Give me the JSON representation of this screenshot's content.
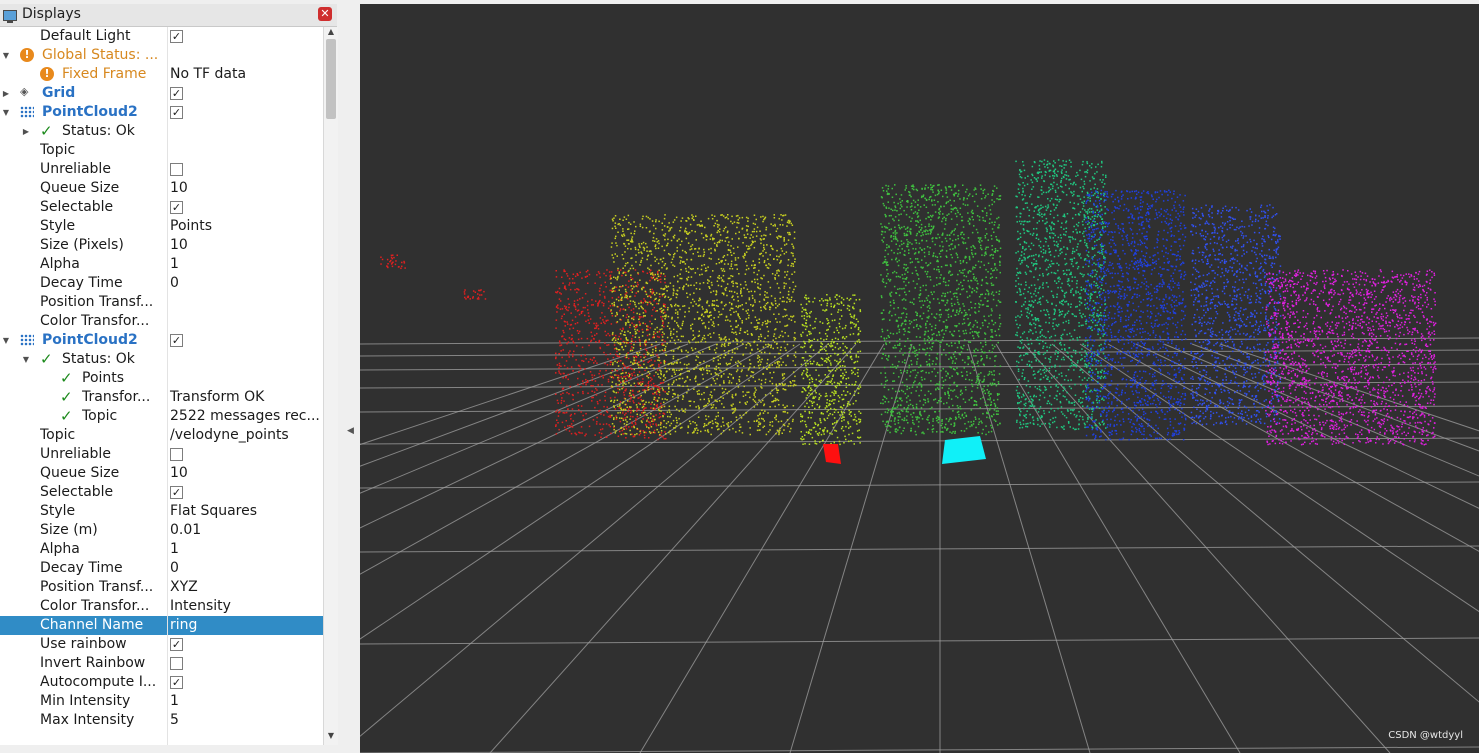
{
  "panel": {
    "title": "Displays",
    "close_glyph": "✕",
    "rows": [
      {
        "indent": 0,
        "arrow": "",
        "icon": "",
        "name": "Default Light",
        "value": "",
        "checkbox": true,
        "checked": true
      },
      {
        "indent": 0,
        "arrow": "▼",
        "icon": "warning",
        "name": "Global Status: ...",
        "value": "",
        "checkbox": false,
        "style": "orange"
      },
      {
        "indent": 1,
        "arrow": "",
        "icon": "warning",
        "name": "Fixed Frame",
        "value": "No TF data",
        "checkbox": false,
        "style": "orange"
      },
      {
        "indent": 0,
        "arrow": "▶",
        "icon": "grid",
        "name": "Grid",
        "value": "",
        "checkbox": true,
        "checked": true,
        "style": "blue"
      },
      {
        "indent": 0,
        "arrow": "▼",
        "icon": "pointcloud",
        "name": "PointCloud2",
        "value": "",
        "checkbox": true,
        "checked": true,
        "style": "blue"
      },
      {
        "indent": 1,
        "arrow": "▶",
        "icon": "check",
        "name": "Status: Ok",
        "value": "",
        "checkbox": false
      },
      {
        "indent": 1,
        "arrow": "",
        "icon": "",
        "name": "Topic",
        "value": "",
        "checkbox": false
      },
      {
        "indent": 1,
        "arrow": "",
        "icon": "",
        "name": "Unreliable",
        "value": "",
        "checkbox": true,
        "checked": false
      },
      {
        "indent": 1,
        "arrow": "",
        "icon": "",
        "name": "Queue Size",
        "value": "10",
        "checkbox": false
      },
      {
        "indent": 1,
        "arrow": "",
        "icon": "",
        "name": "Selectable",
        "value": "",
        "checkbox": true,
        "checked": true
      },
      {
        "indent": 1,
        "arrow": "",
        "icon": "",
        "name": "Style",
        "value": "Points",
        "checkbox": false
      },
      {
        "indent": 1,
        "arrow": "",
        "icon": "",
        "name": "Size (Pixels)",
        "value": "10",
        "checkbox": false
      },
      {
        "indent": 1,
        "arrow": "",
        "icon": "",
        "name": "Alpha",
        "value": "1",
        "checkbox": false
      },
      {
        "indent": 1,
        "arrow": "",
        "icon": "",
        "name": "Decay Time",
        "value": "0",
        "checkbox": false
      },
      {
        "indent": 1,
        "arrow": "",
        "icon": "",
        "name": "Position Transf...",
        "value": "",
        "checkbox": false
      },
      {
        "indent": 1,
        "arrow": "",
        "icon": "",
        "name": "Color Transfor...",
        "value": "",
        "checkbox": false
      },
      {
        "indent": 0,
        "arrow": "▼",
        "icon": "pointcloud",
        "name": "PointCloud2",
        "value": "",
        "checkbox": true,
        "checked": true,
        "style": "blue"
      },
      {
        "indent": 1,
        "arrow": "▼",
        "icon": "check",
        "name": "Status: Ok",
        "value": "",
        "checkbox": false
      },
      {
        "indent": 2,
        "arrow": "",
        "icon": "check",
        "name": "Points",
        "value": "",
        "checkbox": false
      },
      {
        "indent": 2,
        "arrow": "",
        "icon": "check",
        "name": "Transfor...",
        "value": "Transform OK",
        "checkbox": false
      },
      {
        "indent": 2,
        "arrow": "",
        "icon": "check",
        "name": "Topic",
        "value": "2522 messages rec...",
        "checkbox": false
      },
      {
        "indent": 1,
        "arrow": "",
        "icon": "",
        "name": "Topic",
        "value": "/velodyne_points",
        "checkbox": false
      },
      {
        "indent": 1,
        "arrow": "",
        "icon": "",
        "name": "Unreliable",
        "value": "",
        "checkbox": true,
        "checked": false
      },
      {
        "indent": 1,
        "arrow": "",
        "icon": "",
        "name": "Queue Size",
        "value": "10",
        "checkbox": false
      },
      {
        "indent": 1,
        "arrow": "",
        "icon": "",
        "name": "Selectable",
        "value": "",
        "checkbox": true,
        "checked": true
      },
      {
        "indent": 1,
        "arrow": "",
        "icon": "",
        "name": "Style",
        "value": "Flat Squares",
        "checkbox": false
      },
      {
        "indent": 1,
        "arrow": "",
        "icon": "",
        "name": "Size (m)",
        "value": "0.01",
        "checkbox": false
      },
      {
        "indent": 1,
        "arrow": "",
        "icon": "",
        "name": "Alpha",
        "value": "1",
        "checkbox": false
      },
      {
        "indent": 1,
        "arrow": "",
        "icon": "",
        "name": "Decay Time",
        "value": "0",
        "checkbox": false
      },
      {
        "indent": 1,
        "arrow": "",
        "icon": "",
        "name": "Position Transf...",
        "value": "XYZ",
        "checkbox": false
      },
      {
        "indent": 1,
        "arrow": "",
        "icon": "",
        "name": "Color Transfor...",
        "value": "Intensity",
        "checkbox": false
      },
      {
        "indent": 1,
        "arrow": "",
        "icon": "",
        "name": "Channel Name",
        "value": "ring",
        "checkbox": false,
        "selected": true
      },
      {
        "indent": 1,
        "arrow": "",
        "icon": "",
        "name": "Use rainbow",
        "value": "",
        "checkbox": true,
        "checked": true
      },
      {
        "indent": 1,
        "arrow": "",
        "icon": "",
        "name": "Invert Rainbow",
        "value": "",
        "checkbox": true,
        "checked": false
      },
      {
        "indent": 1,
        "arrow": "",
        "icon": "",
        "name": "Autocompute I...",
        "value": "",
        "checkbox": true,
        "checked": true
      },
      {
        "indent": 1,
        "arrow": "",
        "icon": "",
        "name": "Min Intensity",
        "value": "1",
        "checkbox": false
      },
      {
        "indent": 1,
        "arrow": "",
        "icon": "",
        "name": "Max Intensity",
        "value": "5",
        "checkbox": false
      }
    ]
  },
  "viewport": {
    "background": "#303030",
    "grid_color": "#a0a0a0",
    "watermark": "CSDN @wtdyyl",
    "cloud_colors": [
      "#e02020",
      "#c8d020",
      "#b8e020",
      "#40c040",
      "#20c880",
      "#2040e0",
      "#3050f0",
      "#e020e0"
    ]
  },
  "check_glyph": "✓",
  "icons": {
    "warning": "warning-icon",
    "grid": "grid-icon",
    "pointcloud": "pointcloud-icon",
    "check": "status-ok-icon",
    "monitor": "monitor-icon",
    "close": "close-icon"
  }
}
